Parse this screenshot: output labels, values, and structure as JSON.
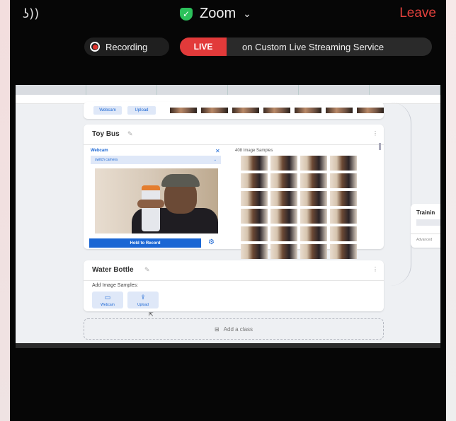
{
  "zoom": {
    "title": "Zoom",
    "leave_label": "Leave",
    "recording_label": "Recording",
    "live_label": "LIVE",
    "streaming_text": "on Custom Live Streaming Service"
  },
  "shared_screen": {
    "top_card": {
      "webcam_label": "Webcam",
      "upload_label": "Upload"
    },
    "toy_bus": {
      "title": "Toy Bus",
      "webcam_label": "Webcam",
      "select_value": "switch camera",
      "hold_label": "Hold to Record",
      "samples_label": "408 Image Samples"
    },
    "water_bottle": {
      "title": "Water Bottle",
      "add_samples_label": "Add Image Samples:",
      "webcam_label": "Webcam",
      "upload_label": "Upload"
    },
    "add_class_label": "Add a class",
    "training": {
      "title": "Trainin",
      "advanced_label": "Advanced"
    }
  }
}
